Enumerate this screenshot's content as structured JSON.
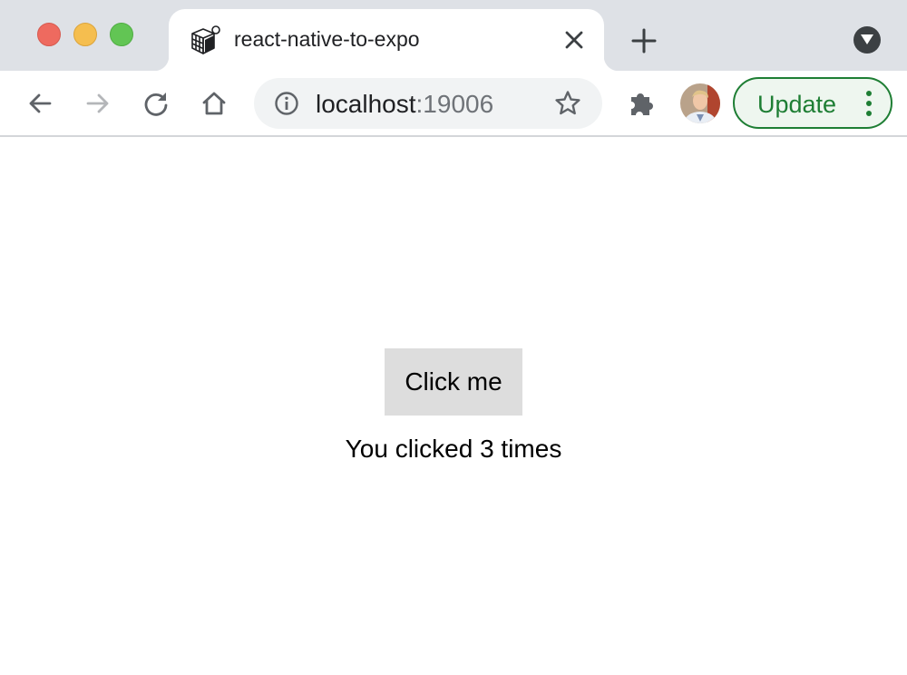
{
  "browser": {
    "tab": {
      "title": "react-native-to-expo"
    },
    "address": {
      "host": "localhost",
      "port": ":19006"
    },
    "update_button": {
      "label": "Update"
    }
  },
  "page": {
    "button_label": "Click me",
    "click_count_text": "You clicked 3 times"
  },
  "colors": {
    "tabstrip_bg": "#dee1e6",
    "omnibox_bg": "#f1f3f4",
    "update_accent": "#1e7e34",
    "button_bg": "#dddddd"
  },
  "icons": {
    "window_controls": [
      "close-dot",
      "minimize-dot",
      "maximize-dot"
    ],
    "tab_favicon": "expo-cube-icon",
    "toolbar": [
      "back-arrow-icon",
      "forward-arrow-icon",
      "reload-icon",
      "home-icon",
      "info-icon",
      "star-icon",
      "puzzle-extension-icon",
      "kebab-menu-icon"
    ]
  }
}
